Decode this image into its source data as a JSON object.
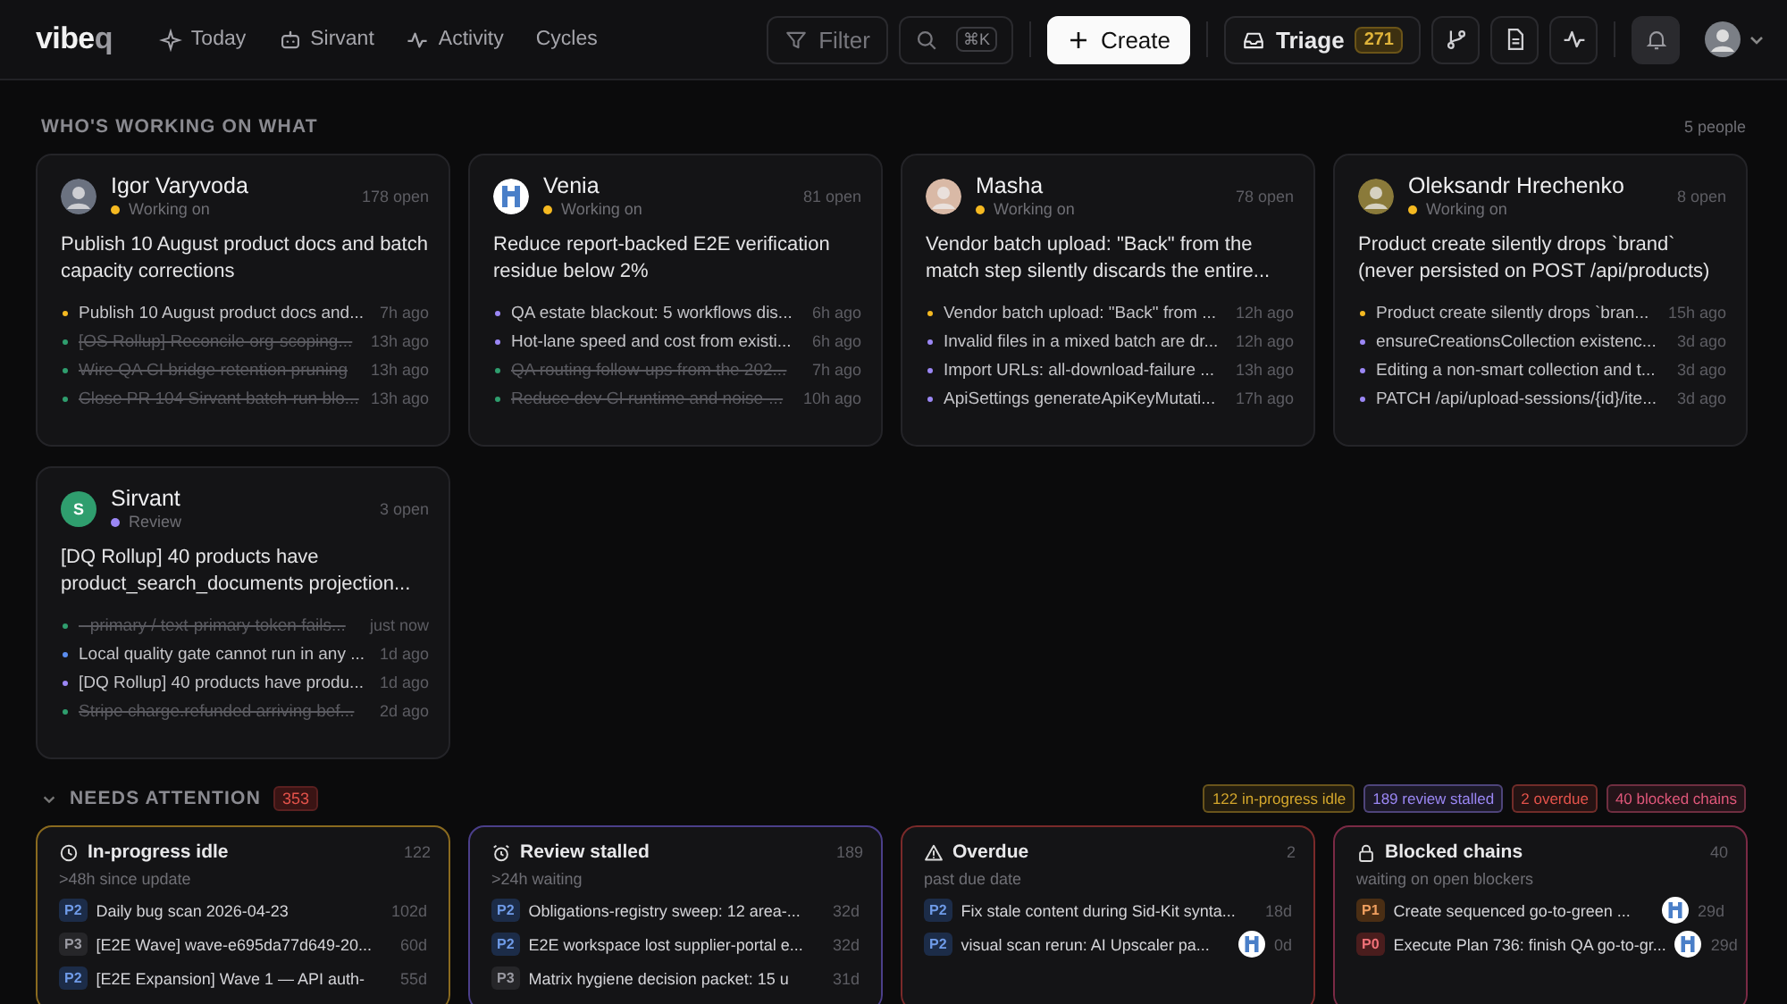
{
  "topbar": {
    "brand": "vibe",
    "brand_suffix": "q",
    "nav": [
      {
        "label": "Today"
      },
      {
        "label": "Sirvant"
      },
      {
        "label": "Activity"
      },
      {
        "label": "Cycles"
      }
    ],
    "filter": {
      "label": "Filter"
    },
    "search": {
      "shortcut": "⌘K"
    },
    "create": {
      "label": "Create"
    },
    "triage": {
      "label": "Triage",
      "count": "271"
    },
    "tools": [
      {
        "selected": false
      },
      {
        "selected": false
      },
      {
        "selected": false
      },
      {
        "selected": true
      }
    ]
  },
  "working": {
    "title": "WHO'S WORKING ON WHAT",
    "count": "5 people",
    "people": [
      {
        "name": "Igor Varyvoda",
        "color": "#f5b921",
        "status_label": "Working on",
        "open": "178 open",
        "task": "Publish 10 August product docs and batch capacity corrections",
        "items": [
          {
            "text": "Publish 10 August product docs and...",
            "time": "7h ago",
            "kind": "active"
          },
          {
            "text": "[OS Rollup] Reconcile org-scoping...",
            "time": "13h ago",
            "kind": "done"
          },
          {
            "text": "Wire QA CI bridge retention pruning",
            "time": "13h ago",
            "kind": "done"
          },
          {
            "text": "Close PR 104 Sirvant batch-run blo...",
            "time": "13h ago",
            "kind": "done"
          }
        ]
      },
      {
        "name": "Venia",
        "color": "#f5b921",
        "status_label": "Working on",
        "open": "81 open",
        "task": "Reduce report-backed E2E verification residue below 2%",
        "items": [
          {
            "text": "QA estate blackout: 5 workflows dis...",
            "time": "6h ago",
            "kind": "review"
          },
          {
            "text": "Hot-lane speed and cost from existi...",
            "time": "6h ago",
            "kind": "review"
          },
          {
            "text": "QA routing follow-ups from the 202...",
            "time": "7h ago",
            "kind": "done"
          },
          {
            "text": "Reduce dev CI runtime and noise-...",
            "time": "10h ago",
            "kind": "done"
          }
        ]
      },
      {
        "name": "Masha",
        "color": "#f5b921",
        "status_label": "Working on",
        "open": "78 open",
        "task": "Vendor batch upload: \"Back\" from the match step silently discards the entire...",
        "items": [
          {
            "text": "Vendor batch upload: \"Back\" from ...",
            "time": "12h ago",
            "kind": "active"
          },
          {
            "text": "Invalid files in a mixed batch are dr...",
            "time": "12h ago",
            "kind": "review"
          },
          {
            "text": "Import URLs: all-download-failure ...",
            "time": "13h ago",
            "kind": "review"
          },
          {
            "text": "ApiSettings generateApiKeyMutati...",
            "time": "17h ago",
            "kind": "review"
          }
        ]
      },
      {
        "name": "Oleksandr Hrechenko",
        "color": "#f5b921",
        "status_label": "Working on",
        "open": "8 open",
        "task": "Product create silently drops `brand` (never persisted on POST /api/products)",
        "items": [
          {
            "text": "Product create silently drops `bran...",
            "time": "15h ago",
            "kind": "active"
          },
          {
            "text": "ensureCreationsCollection existenc...",
            "time": "3d ago",
            "kind": "review"
          },
          {
            "text": "Editing a non-smart collection and t...",
            "time": "3d ago",
            "kind": "review"
          },
          {
            "text": "PATCH /api/upload-sessions/{id}/ite...",
            "time": "3d ago",
            "kind": "review"
          }
        ]
      },
      {
        "name": "Sirvant",
        "initial": "S",
        "color": "#9b87f5",
        "status_label": "Review",
        "open": "3 open",
        "task": "[DQ Rollup] 40 products have product_search_documents projection...",
        "items": [
          {
            "text": "--primary / text-primary token fails...",
            "time": "just now",
            "kind": "done"
          },
          {
            "text": "Local quality gate cannot run in any ...",
            "time": "1d ago",
            "kind": "todo"
          },
          {
            "text": "[DQ Rollup] 40 products have produ...",
            "time": "1d ago",
            "kind": "review"
          },
          {
            "text": "Stripe charge.refunded arriving bef...",
            "time": "2d ago",
            "kind": "done"
          }
        ]
      }
    ]
  },
  "attention": {
    "title": "NEEDS ATTENTION",
    "count": "353",
    "expanded": true,
    "chips": [
      {
        "label": "122 in-progress idle",
        "color": "#d4a72c"
      },
      {
        "label": "189 review stalled",
        "color": "#9b87f5"
      },
      {
        "label": "2 overdue",
        "color": "#e5534b"
      },
      {
        "label": "40 blocked chains",
        "color": "#e0577a"
      }
    ],
    "groups": [
      {
        "title": "In-progress idle",
        "color": "#8a6a1f",
        "count": "122",
        "subtitle": ">48h since update",
        "rows": [
          {
            "priority": "P2",
            "text": "Daily bug scan 2026-04-23",
            "age": "102d",
            "assignee": false
          },
          {
            "priority": "P3",
            "text": "[E2E Wave] wave-e695da77d649-20...",
            "age": "60d",
            "assignee": false
          },
          {
            "priority": "P2",
            "text": "[E2E Expansion] Wave 1 — API auth-",
            "age": "55d",
            "assignee": false
          }
        ]
      },
      {
        "title": "Review stalled",
        "color": "#4b3f8a",
        "count": "189",
        "subtitle": ">24h waiting",
        "rows": [
          {
            "priority": "P2",
            "text": "Obligations-registry sweep: 12 area-...",
            "age": "32d",
            "assignee": false
          },
          {
            "priority": "P2",
            "text": "E2E workspace lost supplier-portal e...",
            "age": "32d",
            "assignee": false
          },
          {
            "priority": "P3",
            "text": "Matrix hygiene decision packet: 15 u",
            "age": "31d",
            "assignee": false
          }
        ]
      },
      {
        "title": "Overdue",
        "color": "#7a2a2a",
        "count": "2",
        "subtitle": "past due date",
        "rows": [
          {
            "priority": "P2",
            "text": "Fix stale content during Sid-Kit synta...",
            "age": "18d",
            "assignee": false
          },
          {
            "priority": "P2",
            "text": "visual scan rerun: AI Upscaler pa...",
            "age": "0d",
            "assignee": true
          }
        ]
      },
      {
        "title": "Blocked chains",
        "color": "#7a2a45",
        "count": "40",
        "subtitle": "waiting on open blockers",
        "rows": [
          {
            "priority": "P1",
            "text": "Create sequenced go-to-green ...",
            "age": "29d",
            "assignee": true
          },
          {
            "priority": "P0",
            "text": "Execute Plan 736: finish QA go-to-gr...",
            "age": "29d",
            "assignee": true
          }
        ]
      }
    ]
  }
}
